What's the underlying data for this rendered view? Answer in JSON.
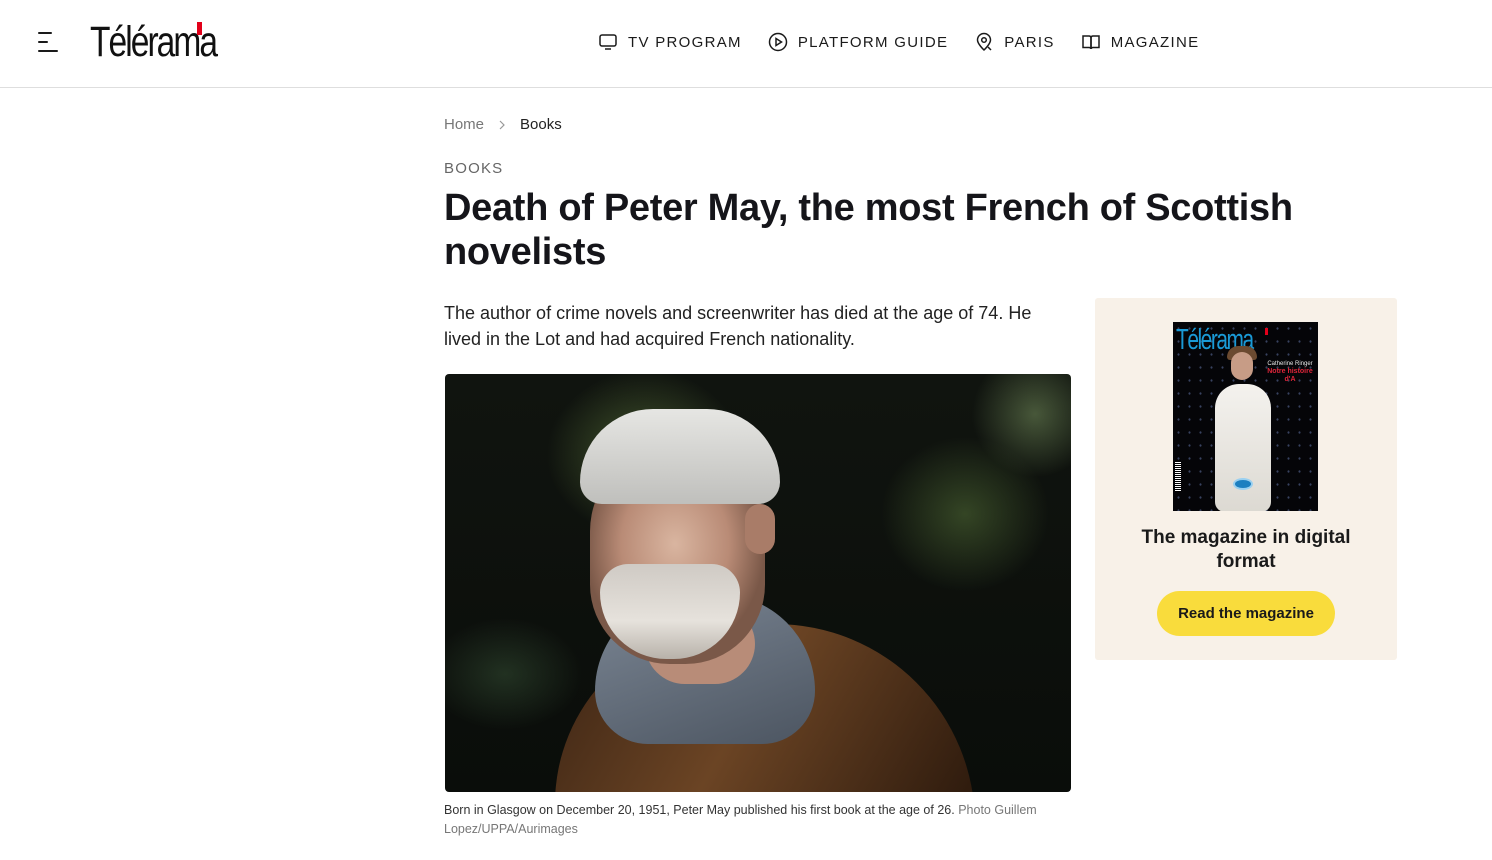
{
  "header": {
    "logo_text": "Télérama",
    "brand_accent_color": "#e2001a",
    "nav": [
      {
        "label": "TV PROGRAM",
        "icon": "tv-icon"
      },
      {
        "label": "PLATFORM GUIDE",
        "icon": "play-circle-icon"
      },
      {
        "label": "PARIS",
        "icon": "map-pin-icon"
      },
      {
        "label": "MAGAZINE",
        "icon": "open-book-icon"
      }
    ]
  },
  "breadcrumb": {
    "home": "Home",
    "current": "Books"
  },
  "article": {
    "kicker": "BOOKS",
    "title": "Death of Peter May, the most French of Scottish novelists",
    "lede": "The author of crime novels and screenwriter has died at the age of 74. He lived in the Lot and had acquired French nationality.",
    "caption": "Born in Glasgow on December 20, 1951, Peter May published his first book at the age of 26.",
    "credit": "Photo Guillem Lopez/UPPA/Aurimages"
  },
  "promo": {
    "cover_logo": "Télérama",
    "cover_headline_1": "Catherine Ringer",
    "cover_headline_2": "Notre histoire d'A",
    "title": "The magazine in digital format",
    "button_label": "Read the magazine",
    "button_color": "#f9dc3c",
    "background_color": "#f8f1e8"
  }
}
